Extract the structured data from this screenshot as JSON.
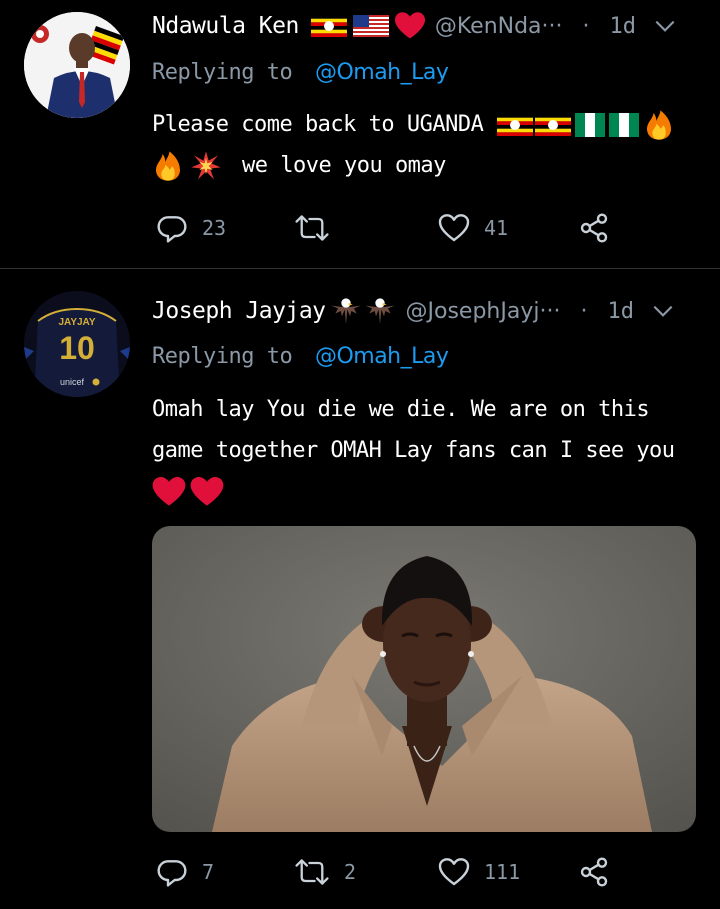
{
  "tweets": [
    {
      "name": "Ndawula Ken",
      "handle": "@KenNda···",
      "separator": "·",
      "time": "1d",
      "replying_label": "Replying to",
      "replying_to": "@Omah_Lay",
      "body_line1": "Please come back to UGANDA",
      "body_line2": "we love you omay",
      "replies": "23",
      "retweets": "",
      "likes": "41",
      "name_emojis": [
        "uganda-flag",
        "us-flag",
        "red-heart"
      ],
      "body_emojis": [
        "uganda-flag",
        "uganda-flag",
        "nigeria-flag",
        "nigeria-flag",
        "fire",
        "fire",
        "collision"
      ]
    },
    {
      "name": "Joseph Jayjay",
      "handle": "@JosephJayj···",
      "separator": "·",
      "time": "1d",
      "replying_label": "Replying to",
      "replying_to": "@Omah_Lay",
      "body_line1": "Omah lay You die we die. We are on this",
      "body_line2": "game together OMAH Lay fans can I see you",
      "replies": "7",
      "retweets": "2",
      "likes": "111",
      "name_emojis": [
        "eagle",
        "eagle"
      ],
      "body_emojis": [
        "red-heart",
        "red-heart"
      ],
      "avatar_text": "JAYJAY",
      "avatar_number": "10",
      "avatar_sponsor": "unicef"
    }
  ],
  "colors": {
    "background": "#000000",
    "text": "#ffffff",
    "muted": "#8b98a5",
    "link": "#1d9bf0",
    "divider": "#2f3336",
    "heart": "#e0103a"
  }
}
